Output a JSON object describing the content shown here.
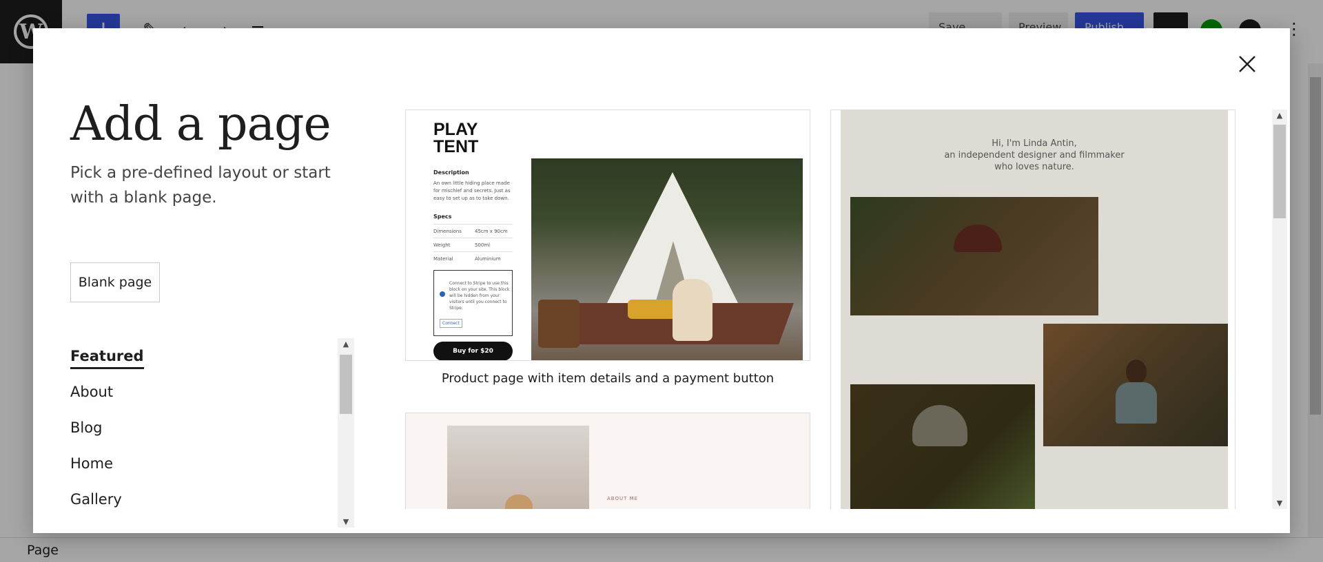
{
  "editor": {
    "statusbar_label": "Page",
    "wp_logo_letter": "W",
    "toolbar": {
      "add_label": "+",
      "save_draft_label": "Save draft",
      "preview_label": "Preview",
      "publish_label": "Publish"
    }
  },
  "modal": {
    "title": "Add a page",
    "description": "Pick a pre-defined layout or start with a blank page.",
    "blank_page_label": "Blank page",
    "close_icon": "close-icon",
    "categories": [
      {
        "label": "Featured",
        "active": true
      },
      {
        "label": "About",
        "active": false
      },
      {
        "label": "Blog",
        "active": false
      },
      {
        "label": "Home",
        "active": false
      },
      {
        "label": "Gallery",
        "active": false
      }
    ],
    "layouts": [
      {
        "caption": "Product page with item details and a payment button",
        "preview": {
          "title_line1": "PLAY",
          "title_line2": "TENT",
          "description_heading": "Description",
          "description_text": "An own little hiding place made for mischief and secrets. Just as easy to set up as to take down.",
          "specs_heading": "Specs",
          "specs": [
            {
              "name": "Dimensions",
              "value": "45cm x 90cm"
            },
            {
              "name": "Weight",
              "value": "500ml"
            },
            {
              "name": "Material",
              "value": "Aluminium"
            }
          ],
          "stripe_notice": "Connect to Stripe to use this block on your site. This block will be hidden from your visitors until you connect to Stripe.",
          "stripe_connect": "Connect",
          "buy_label": "Buy for $20"
        }
      },
      {
        "caption": "",
        "preview": {
          "about_label": "ABOUT ME"
        }
      },
      {
        "caption": "",
        "preview": {
          "intro_line1": "Hi, I'm Linda Antin,",
          "intro_line2": "an independent designer and filmmaker",
          "intro_line3": "who loves nature."
        }
      }
    ]
  },
  "colors": {
    "accent": "#3858e9",
    "text": "#1e1e1e",
    "scrim": "rgba(0,0,0,0.35)"
  }
}
